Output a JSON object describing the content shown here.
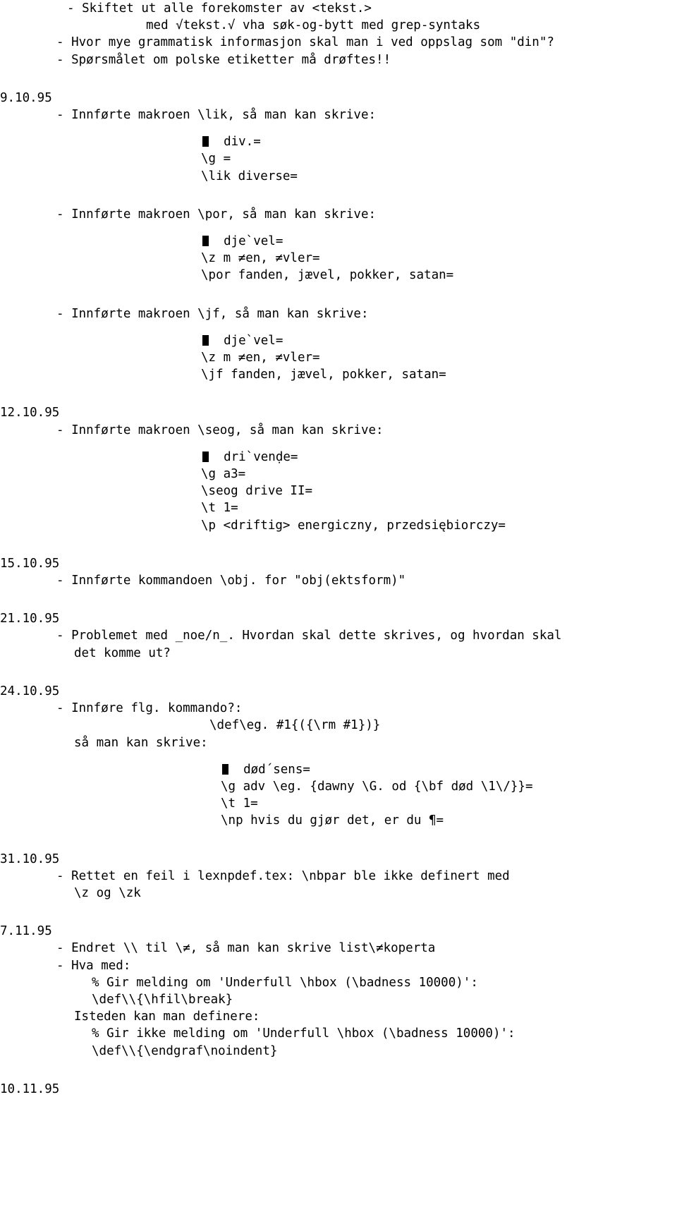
{
  "document": {
    "type": "changelog",
    "language": "Norwegian",
    "bullet_glyph": "black-square",
    "text_color": "#000000",
    "background_color": "#ffffff",
    "blocks": [
      {
        "kind": "entry-lines",
        "lines": [
          {
            "indent": 95,
            "text": "- Skiftet ut alle forekomster av <tekst.>"
          },
          {
            "indent": 207,
            "text": "med √tekst.√ vha søk-og-bytt med grep-syntaks"
          },
          {
            "indent": 80,
            "text": "- Hvor mye grammatisk informasjon skal man i ved oppslag som \"din\"?"
          },
          {
            "indent": 80,
            "text": "- Spørsmålet om polske etiketter må drøftes!!"
          }
        ]
      },
      {
        "kind": "date",
        "date": "9.10.95",
        "lines": [
          {
            "indent": 80,
            "text": "- Innførte makroen \\lik, så man kan skrive:"
          }
        ]
      },
      {
        "kind": "code",
        "first_line_bullet": true,
        "lines": [
          {
            "indent": 287,
            "text": "div.="
          },
          {
            "indent": 285,
            "text": "\\g ="
          },
          {
            "indent": 285,
            "text": "\\lik diverse="
          }
        ]
      },
      {
        "kind": "entry-lines",
        "lines": [
          {
            "indent": 80,
            "text": "- Innførte makroen \\por, så man kan skrive:"
          }
        ]
      },
      {
        "kind": "code",
        "first_line_bullet": true,
        "lines": [
          {
            "indent": 287,
            "text": "dje`vel="
          },
          {
            "indent": 285,
            "text": "\\z m ≠en, ≠vler="
          },
          {
            "indent": 285,
            "text": "\\por fanden, jævel, pokker, satan="
          }
        ]
      },
      {
        "kind": "entry-lines",
        "lines": [
          {
            "indent": 80,
            "text": "- Innførte makroen \\jf, så man kan skrive:"
          }
        ]
      },
      {
        "kind": "code",
        "first_line_bullet": true,
        "lines": [
          {
            "indent": 287,
            "text": "dje`vel="
          },
          {
            "indent": 285,
            "text": "\\z m ≠en, ≠vler="
          },
          {
            "indent": 285,
            "text": "\\jf fanden, jævel, pokker, satan="
          }
        ]
      },
      {
        "kind": "date",
        "date": "12.10.95",
        "lines": [
          {
            "indent": 80,
            "text": "- Innførte makroen \\seog, så man kan skrive:"
          }
        ]
      },
      {
        "kind": "code",
        "first_line_bullet": true,
        "lines": [
          {
            "indent": 287,
            "text": "dri`venḍe="
          },
          {
            "indent": 285,
            "text": "\\g a3="
          },
          {
            "indent": 285,
            "text": "\\seog drive II="
          },
          {
            "indent": 285,
            "text": "\\t 1="
          },
          {
            "indent": 285,
            "text": "\\p <driftig> energiczny, przedsiębiorczy="
          }
        ]
      },
      {
        "kind": "date",
        "date": "15.10.95",
        "lines": [
          {
            "indent": 80,
            "text": "- Innførte kommandoen \\obj. for \"obj(ektsform)\""
          }
        ]
      },
      {
        "kind": "date",
        "date": "21.10.95",
        "lines": [
          {
            "indent": 80,
            "text": "- Problemet med _noe/n_. Hvordan skal dette skrives, og hvordan skal"
          },
          {
            "indent": 105,
            "text": "det komme ut?"
          }
        ]
      },
      {
        "kind": "date",
        "date": "24.10.95",
        "lines": [
          {
            "indent": 80,
            "text": "- Innføre flg. kommando?:"
          },
          {
            "indent": 297,
            "text": "\\def\\eg. #1{({\\rm #1})}"
          },
          {
            "indent": 105,
            "text": "så man kan skrive:"
          }
        ]
      },
      {
        "kind": "code",
        "first_line_bullet": true,
        "lines": [
          {
            "indent": 315,
            "text": "død´sens="
          },
          {
            "indent": 313,
            "text": "\\g adv \\eg. {dawny \\G. od {\\bf død \\1\\/}}="
          },
          {
            "indent": 313,
            "text": "\\t 1="
          },
          {
            "indent": 313,
            "text": "\\np hvis du gjør det, er du ¶="
          }
        ]
      },
      {
        "kind": "date",
        "date": "31.10.95",
        "lines": [
          {
            "indent": 80,
            "text": "- Rettet en feil i lexnpdef.tex: \\nbpar ble ikke definert med"
          },
          {
            "indent": 105,
            "text": "\\z og \\zk"
          }
        ]
      },
      {
        "kind": "date",
        "date": "7.11.95",
        "lines": [
          {
            "indent": 80,
            "text": "- Endret \\\\ til \\≠, så man kan skrive list\\≠koperta"
          },
          {
            "indent": 80,
            "text": "- Hva med:"
          },
          {
            "indent": 130,
            "text": "% Gir melding om 'Underfull \\hbox (\\badness 10000)':"
          },
          {
            "indent": 130,
            "text": "\\def\\\\{\\hfil\\break}"
          },
          {
            "indent": 105,
            "text": "Isteden kan man definere:"
          },
          {
            "indent": 130,
            "text": "% Gir ikke melding om 'Underfull \\hbox (\\badness 10000)':"
          },
          {
            "indent": 130,
            "text": "\\def\\\\{\\endgraf\\noindent}"
          }
        ]
      },
      {
        "kind": "date",
        "date": "10.11.95",
        "lines": []
      }
    ]
  }
}
